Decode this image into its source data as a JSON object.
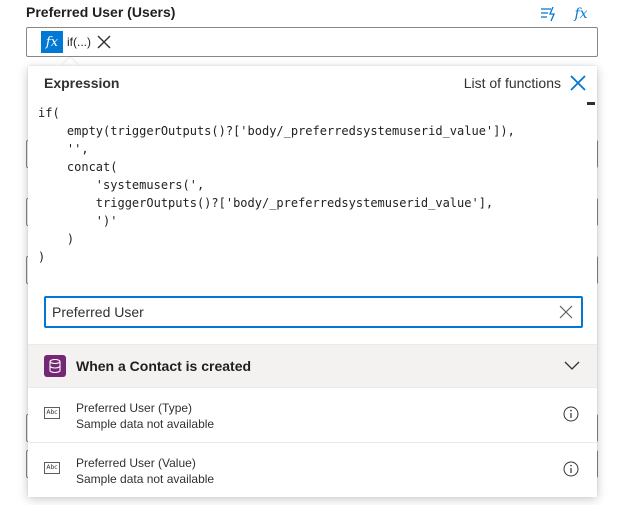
{
  "field": {
    "title": "Preferred User (Users)",
    "token_label": "if(...)"
  },
  "expression_panel": {
    "tab_expression": "Expression",
    "tab_functions": "List of functions",
    "code": "if(\n    empty(triggerOutputs()?['body/_preferredsystemuserid_value']),\n    '',\n    concat(\n        'systemusers(',\n        triggerOutputs()?['body/_preferredsystemuserid_value'],\n        ')'\n    )\n)",
    "search_value": "Preferred User",
    "group_title": "When a Contact is created",
    "items": [
      {
        "name": "Preferred User (Type)",
        "sub": "Sample data not available"
      },
      {
        "name": "Preferred User (Value)",
        "sub": "Sample data not available"
      }
    ]
  },
  "icons": [
    "insert-token-icon",
    "fx-icon",
    "close-icon",
    "clear-icon",
    "dataverse-icon",
    "chevron-down-icon",
    "abc-icon",
    "info-icon"
  ],
  "colors": {
    "accent": "#0078d4",
    "dataverse": "#742774"
  }
}
